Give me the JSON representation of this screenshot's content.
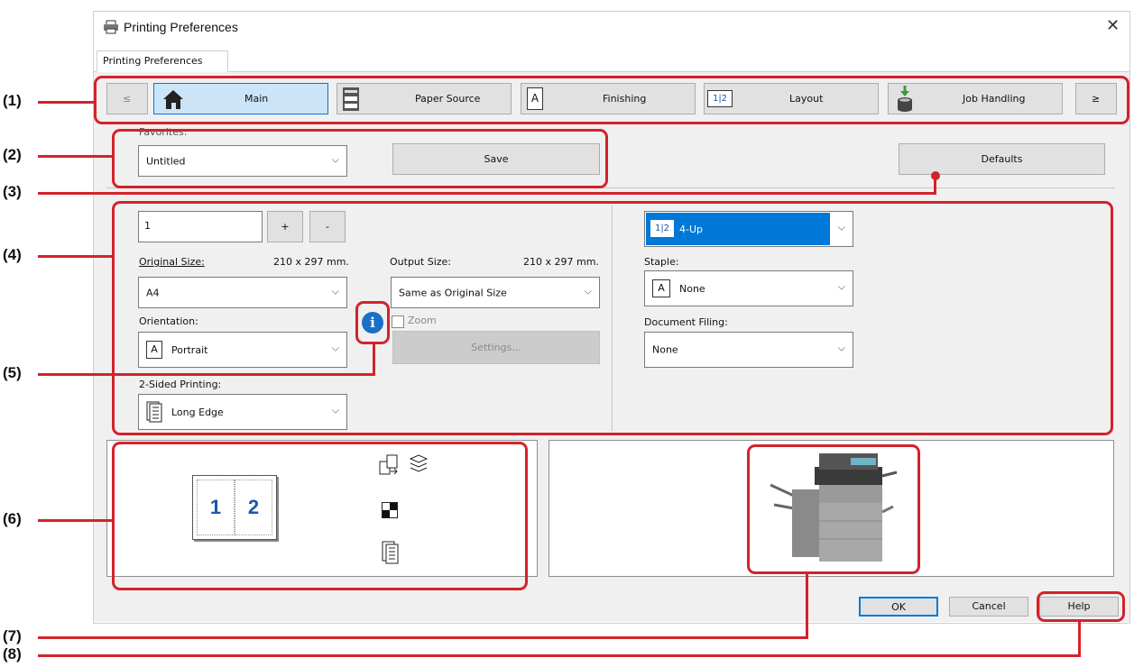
{
  "window": {
    "title": "Printing Preferences",
    "tab_label": "Printing Preferences",
    "close_glyph": "✕"
  },
  "nav": {
    "prev": "≤",
    "next": "≥",
    "tabs": [
      {
        "label": "Main",
        "icon": "home-icon"
      },
      {
        "label": "Paper Source",
        "icon": "paper-tray-icon"
      },
      {
        "label": "Finishing",
        "icon": "finishing-icon",
        "glyph": "A"
      },
      {
        "label": "Layout",
        "icon": "layout-icon",
        "glyph": "1|2"
      },
      {
        "label": "Job Handling",
        "icon": "job-handling-icon"
      }
    ]
  },
  "favorites": {
    "label": "Favorites:",
    "value": "Untitled",
    "save": "Save",
    "defaults": "Defaults"
  },
  "main": {
    "copies": "1",
    "plus": "+",
    "minus": "-",
    "original_size_label": "Original Size:",
    "original_size_dims": "210 x 297 mm.",
    "original_size_value": "A4",
    "output_size_label": "Output Size:",
    "output_size_dims": "210 x 297 mm.",
    "output_size_value": "Same as Original Size",
    "orientation_label": "Orientation:",
    "orientation_value": "Portrait",
    "orientation_glyph": "A",
    "zoom_label": "Zoom",
    "settings_button": "Settings...",
    "two_sided_label": "2-Sided Printing:",
    "two_sided_value": "Long Edge",
    "nup_value": "4-Up",
    "nup_glyph": "1|2",
    "staple_label": "Staple:",
    "staple_value": "None",
    "staple_glyph": "A",
    "doc_filing_label": "Document Filing:",
    "doc_filing_value": "None"
  },
  "preview": {
    "page1": "1",
    "page2": "2"
  },
  "footer": {
    "ok": "OK",
    "cancel": "Cancel",
    "help": "Help"
  },
  "callouts": [
    "(1)",
    "(2)",
    "(3)",
    "(4)",
    "(5)",
    "(6)",
    "(7)",
    "(8)"
  ],
  "colors": {
    "callout": "#d2232a",
    "accent": "#0078d7",
    "selected_tab": "#cce4f7"
  }
}
